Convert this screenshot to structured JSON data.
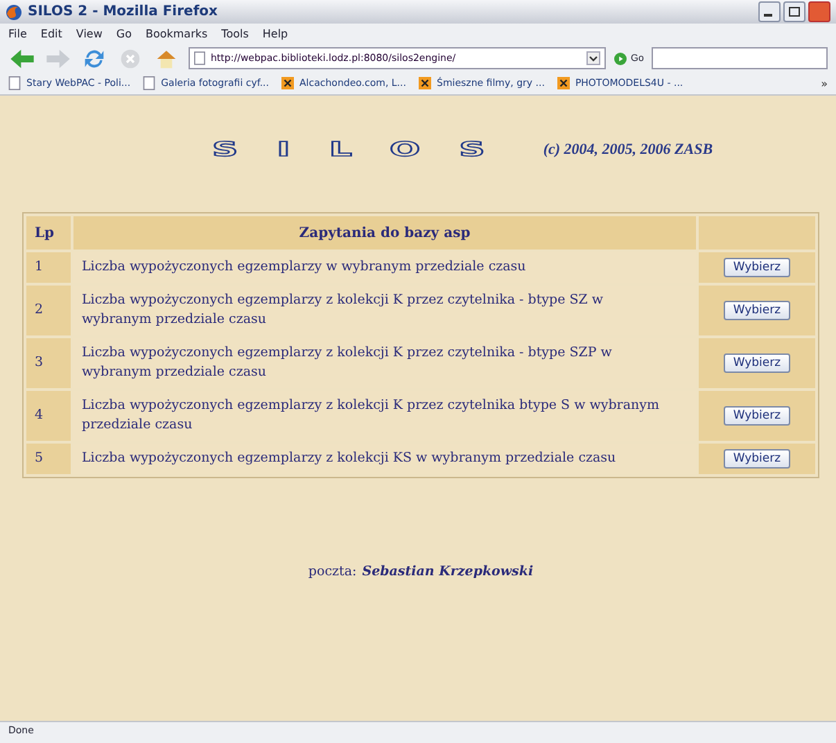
{
  "window": {
    "title": "SILOS 2 - Mozilla Firefox"
  },
  "menu": [
    "File",
    "Edit",
    "View",
    "Go",
    "Bookmarks",
    "Tools",
    "Help"
  ],
  "address": {
    "value": "http://webpac.biblioteki.lodz.pl:8080/silos2engine/"
  },
  "go_label": "Go",
  "bookmarks": [
    {
      "label": "Stary WebPAC - Poli...",
      "kind": "page"
    },
    {
      "label": "Galeria fotografii cyf...",
      "kind": "page"
    },
    {
      "label": "Alcachondeo.com, L...",
      "kind": "x"
    },
    {
      "label": "Śmieszne filmy, gry ...",
      "kind": "x"
    },
    {
      "label": "PHOTOMODELS4U - ...",
      "kind": "x"
    }
  ],
  "more": "»",
  "logo": "SILOS",
  "copyright": "(c) 2004, 2005, 2006 ZASB",
  "table": {
    "columns": [
      "Lp",
      "Zapytania do bazy asp"
    ],
    "rows": [
      {
        "lp": "1",
        "text": "Liczba wypożyczonych egzemplarzy w wybranym przedziale czasu",
        "button": "Wybierz"
      },
      {
        "lp": "2",
        "text": "Liczba wypożyczonych egzemplarzy z kolekcji K przez czytelnika - btype SZ w wybranym przedziale czasu",
        "button": "Wybierz"
      },
      {
        "lp": "3",
        "text": "Liczba wypożyczonych egzemplarzy z kolekcji K przez czytelnika - btype SZP w wybranym przedziale czasu",
        "button": "Wybierz"
      },
      {
        "lp": "4",
        "text": "Liczba wypożyczonych egzemplarzy z kolekcji K przez czytelnika btype S w wybranym przedziale czasu",
        "button": "Wybierz"
      },
      {
        "lp": "5",
        "text": "Liczba wypożyczonych egzemplarzy z kolekcji KS w wybranym przedziale czasu",
        "button": "Wybierz"
      }
    ]
  },
  "footer": {
    "label": "poczta:",
    "name": "Sebastian Krzepkowski"
  },
  "status_bar": "Done"
}
